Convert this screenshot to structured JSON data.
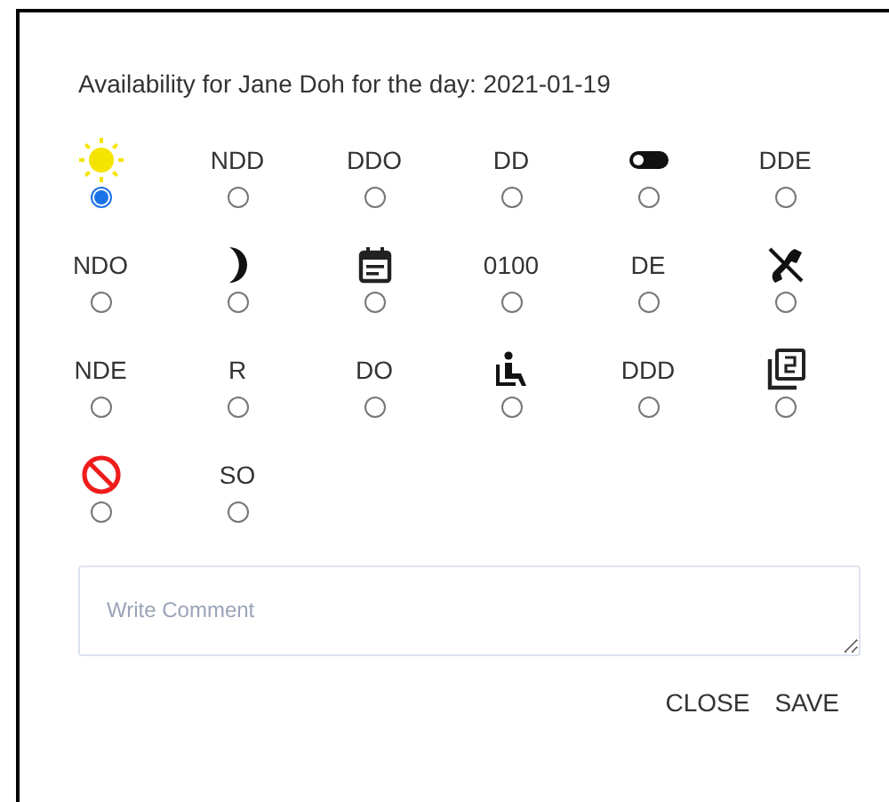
{
  "dialog": {
    "title": "Availability for Jane Doh for the day: 2021-01-19",
    "options": [
      {
        "kind": "sun",
        "selected": true
      },
      {
        "kind": "text",
        "label": "NDD",
        "selected": false
      },
      {
        "kind": "text",
        "label": "DDO",
        "selected": false
      },
      {
        "kind": "text",
        "label": "DD",
        "selected": false
      },
      {
        "kind": "toggle",
        "selected": false
      },
      {
        "kind": "text",
        "label": "DDE",
        "selected": false
      },
      {
        "kind": "text",
        "label": "NDO",
        "selected": false
      },
      {
        "kind": "moon",
        "selected": false
      },
      {
        "kind": "calendar",
        "selected": false
      },
      {
        "kind": "text",
        "label": "0100",
        "selected": false
      },
      {
        "kind": "text",
        "label": "DE",
        "selected": false
      },
      {
        "kind": "phone_off",
        "selected": false
      },
      {
        "kind": "text",
        "label": "NDE",
        "selected": false
      },
      {
        "kind": "text",
        "label": "R",
        "selected": false
      },
      {
        "kind": "text",
        "label": "DO",
        "selected": false
      },
      {
        "kind": "wheelchair",
        "selected": false
      },
      {
        "kind": "text",
        "label": "DDD",
        "selected": false
      },
      {
        "kind": "stack",
        "selected": false
      },
      {
        "kind": "block",
        "selected": false
      },
      {
        "kind": "text",
        "label": "SO",
        "selected": false
      }
    ],
    "comment": {
      "placeholder": "Write Comment"
    },
    "buttons": [
      "CLOSE",
      "SAVE"
    ]
  }
}
